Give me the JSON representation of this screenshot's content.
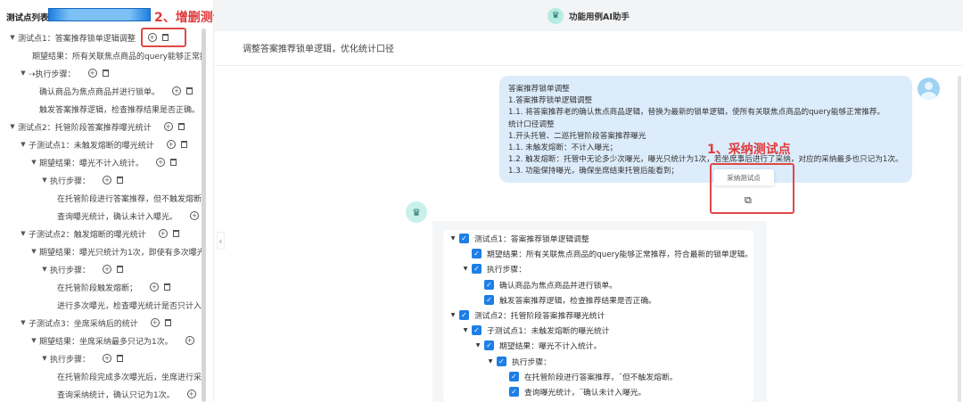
{
  "left_panel": {
    "title": "测试点列表",
    "annotation": "2、增删测试点",
    "rows": [
      {
        "level": 0,
        "arrow": true,
        "text": "测试点1：答案推荐锁单逻辑调整",
        "icons": 2
      },
      {
        "level": 1,
        "arrow": false,
        "text": "期望结果：所有关联焦点商品的query能够正常推",
        "icons": 0
      },
      {
        "level": 1,
        "arrow": true,
        "text": "⇢执行步骤：",
        "icons": 2
      },
      {
        "level": 3,
        "arrow": false,
        "text": "确认商品为焦点商品并进行锁单。",
        "icons": 2
      },
      {
        "level": 3,
        "arrow": false,
        "text": "触发答案推荐逻辑，检查推荐结果是否正确。",
        "icons": 0
      },
      {
        "level": 0,
        "arrow": true,
        "text": "测试点2：托管阶段答案推荐曝光统计",
        "icons": 2
      },
      {
        "level": 1,
        "arrow": true,
        "text": "子测试点1：未触发熔断的曝光统计",
        "icons": 2
      },
      {
        "level": 2,
        "arrow": true,
        "text": "期望结果：曝光不计入统计。",
        "icons": 2
      },
      {
        "level": 3,
        "arrow": true,
        "text": "执行步骤：",
        "icons": 2
      },
      {
        "level": 5,
        "arrow": false,
        "text": "在托管阶段进行答案推荐，但不触发熔断",
        "icons": 0
      },
      {
        "level": 5,
        "arrow": false,
        "text": "查询曝光统计，确认未计入曝光。",
        "icons": 1
      },
      {
        "level": 1,
        "arrow": true,
        "text": "子测试点2：触发熔断的曝光统计",
        "icons": 2
      },
      {
        "level": 2,
        "arrow": true,
        "text": "期望结果：曝光只统计为1次，即使有多次曝光",
        "icons": 0
      },
      {
        "level": 3,
        "arrow": true,
        "text": "执行步骤：",
        "icons": 2
      },
      {
        "level": 5,
        "arrow": false,
        "text": "在托管阶段触发熔断；",
        "icons": 2
      },
      {
        "level": 5,
        "arrow": false,
        "text": "进行多次曝光，检查曝光统计是否只计入",
        "icons": 0
      },
      {
        "level": 1,
        "arrow": true,
        "text": "子测试点3：坐席采纳后的统计",
        "icons": 2
      },
      {
        "level": 2,
        "arrow": true,
        "text": "期望结果：坐席采纳最多只记为1次。",
        "icons": 1
      },
      {
        "level": 3,
        "arrow": true,
        "text": "执行步骤：",
        "icons": 2
      },
      {
        "level": 5,
        "arrow": false,
        "text": "在托管阶段完成多次曝光后，坐席进行采",
        "icons": 0
      },
      {
        "level": 5,
        "arrow": false,
        "text": "查询采纳统计，确认只记为1次。",
        "icons": 1
      }
    ]
  },
  "header": {
    "title": "功能用例AI助手"
  },
  "subject": "调整答案推荐锁单逻辑，优化统计口径",
  "user_message": [
    "答案推荐锁单调整",
    "1.答案推荐锁单逻辑调整",
    "1.1. 将答案推荐老的确认焦点商品逻辑，替换为最新的锁单逻辑，使所有关联焦点商品的query能够正常推荐。",
    "统计口径调整",
    "1.开头托管、二巡托管阶段答案推荐曝光",
    "1.1. 未触发熔断：不计入曝光；",
    "1.2. 触发熔断：托管中无论多少次曝光，曝光只统计为1次，若坐席事后进行了采纳，对应的采纳最多也只记为1次。",
    "1.3. 功能保持曝光，确保坐席结束托管后能看到；"
  ],
  "adopt": {
    "annotation": "1、采纳测试点",
    "tooltip": "采纳测试点"
  },
  "response_tree": [
    {
      "level": 0,
      "arrow": true,
      "text": "测试点1：答案推荐锁单逻辑调整"
    },
    {
      "level": 1,
      "arrow": false,
      "text": "期望结果：所有关联焦点商品的query能够正常推荐，符合最新的锁单逻辑。"
    },
    {
      "level": 1,
      "arrow": true,
      "text": "执行步骤："
    },
    {
      "level": 2,
      "arrow": false,
      "text": "确认商品为焦点商品并进行锁单。"
    },
    {
      "level": 2,
      "arrow": false,
      "text": "触发答案推荐逻辑，检查推荐结果是否正确。"
    },
    {
      "level": 0,
      "arrow": true,
      "text": "测试点2：托管阶段答案推荐曝光统计"
    },
    {
      "level": 1,
      "arrow": true,
      "text": "子测试点1：未触发熔断的曝光统计"
    },
    {
      "level": 2,
      "arrow": true,
      "text": "期望结果：曝光不计入统计。"
    },
    {
      "level": 3,
      "arrow": true,
      "text": "执行步骤："
    },
    {
      "level": 4,
      "arrow": false,
      "text": "在托管阶段进行答案推荐，¨但不触发熔断。"
    },
    {
      "level": 4,
      "arrow": false,
      "text": "查询曝光统计，¨确认未计入曝光。"
    }
  ],
  "colors": {
    "accent": "#1e7ee6",
    "annotation": "#e03a3a",
    "bubble": "#dcecfb"
  }
}
